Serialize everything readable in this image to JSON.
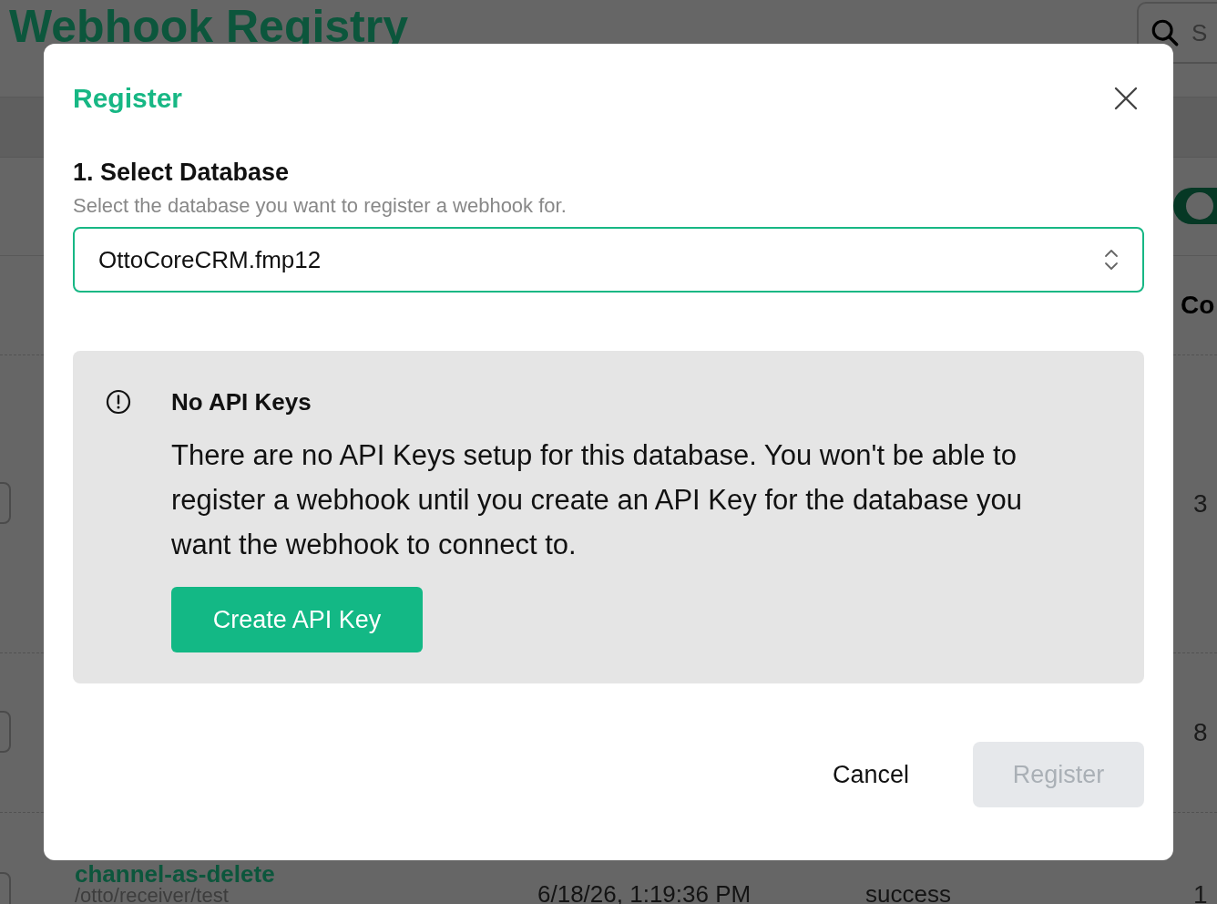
{
  "page": {
    "title": "Webhook Registry",
    "search": {
      "placeholder": "S"
    },
    "toggle": {
      "on": true
    },
    "table": {
      "column_header": "Co",
      "rows": [
        {
          "count": "3"
        },
        {
          "count": "8"
        },
        {
          "name": "channel-as-delete",
          "path": "/otto/receiver/test",
          "time": "6/18/26, 1:19:36 PM",
          "status": "success",
          "count": "1"
        }
      ]
    }
  },
  "dialog": {
    "title": "Register",
    "step": {
      "heading": "1. Select Database",
      "description": "Select the database you want to register a webhook for.",
      "select": {
        "value": "OttoCoreCRM.fmp12"
      }
    },
    "alert": {
      "title": "No API Keys",
      "body": "There are no API Keys setup for this database. You won't be able to register a webhook until you create an API Key for the database you want the webhook to connect to.",
      "button": "Create API Key"
    },
    "buttons": [
      {
        "label": "Cancel",
        "kind": "secondary",
        "disabled": false
      },
      {
        "label": "Register",
        "kind": "primary",
        "disabled": true
      }
    ]
  }
}
